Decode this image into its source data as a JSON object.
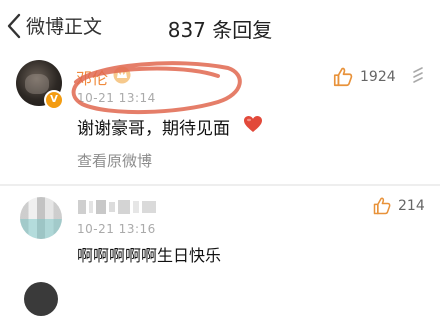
{
  "header": {
    "back_label": "微博正文",
    "title": "837 条回复"
  },
  "comments": [
    {
      "username": "邓伦",
      "timestamp": "10-21 13:14",
      "likes": "1924",
      "text": "谢谢豪哥，期待见面",
      "link": "查看原微博"
    },
    {
      "timestamp": "10-21 13:16",
      "likes": "214",
      "text": "啊啊啊啊啊生日快乐"
    }
  ],
  "colors": {
    "username": "#f08a3c",
    "like_icon": "#e8923a",
    "verified_badge": "#f39c12",
    "annotation_ring": "#e0674f",
    "heart": "#e2493a"
  },
  "icons": [
    "chevron-left-icon",
    "crown-icon",
    "verified-badge-icon",
    "thumbs-up-icon",
    "more-icon",
    "heart-emoji-icon"
  ]
}
